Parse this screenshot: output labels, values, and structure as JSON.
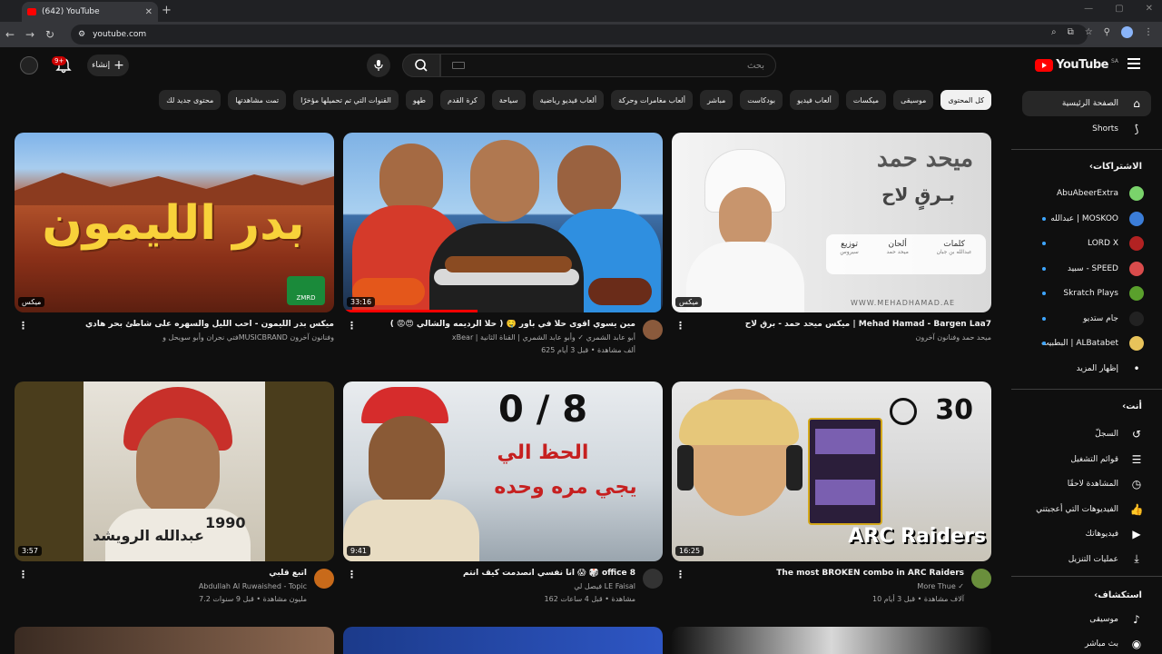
{
  "browser": {
    "tab_title": "(642) YouTube",
    "url": "youtube.com"
  },
  "masthead": {
    "logo": "YouTube",
    "region": "SA",
    "search_placeholder": "بحث",
    "create_label": "إنشاء",
    "notif_count": "9+"
  },
  "chips": [
    "كل المحتوى",
    "موسيقى",
    "ميكسات",
    "ألعاب فيديو",
    "بودكاست",
    "مباشر",
    "ألعاب مغامرات وحركة",
    "ألعاب فيديو رياضية",
    "سياحة",
    "كرة القدم",
    "طهو",
    "القنوات التي تم تحميلها مؤخرًا",
    "تمت مشاهدتها",
    "محتوى جديد لك"
  ],
  "sidebar": {
    "main": [
      {
        "label": "الصفحة الرئيسية",
        "icon": "home-icon"
      },
      {
        "label": "Shorts",
        "icon": "shorts-icon"
      }
    ],
    "subs_header": "الاشتراكات",
    "subs": [
      {
        "label": "AbuAbeerExtra",
        "color": "#7ad36b",
        "dot": false
      },
      {
        "label": "عبدالله | MOSKOO",
        "color": "#3b7dd8",
        "dot": true
      },
      {
        "label": "LORD X",
        "color": "#b22222",
        "dot": true
      },
      {
        "label": "سبيد - SPEED",
        "color": "#d94c4c",
        "dot": true
      },
      {
        "label": "Skratch Plays",
        "color": "#5aa02c",
        "dot": true
      },
      {
        "label": "جام ستديو",
        "color": "#222222",
        "dot": true
      },
      {
        "label": "البطبيت | ALBatabet",
        "color": "#e8c35a",
        "dot": true
      }
    ],
    "show_more": "إظهار المزيد",
    "you_header": "أنت",
    "you": [
      {
        "label": "السجلّ",
        "icon": "history-icon"
      },
      {
        "label": "قوائم التشغيل",
        "icon": "playlists-icon"
      },
      {
        "label": "المشاهدة لاحقًا",
        "icon": "watch-later-icon"
      },
      {
        "label": "الفيديوهات التي أعجبتني",
        "icon": "liked-icon"
      },
      {
        "label": "فيديوهاتك",
        "icon": "your-videos-icon"
      },
      {
        "label": "عمليات التنزيل",
        "icon": "downloads-icon"
      }
    ],
    "explore_header": "استكشاف",
    "explore": [
      {
        "label": "موسيقى",
        "icon": "music-icon"
      },
      {
        "label": "بث مباشر",
        "icon": "live-icon"
      }
    ]
  },
  "videos": [
    {
      "title": "ميكس ميحد حمد - برقٍ لاح | Mehad Hamad - Bargen Laa7",
      "channel": "ميحد حمد وفنانون آخرون",
      "stats": "",
      "badge": "ميكس",
      "thumb_big": "ميحد حمد",
      "thumb_sub": "بـرقٍ لاح",
      "thumb_site": "WWW.MEHADHAMAD.AE",
      "thumb_cols": [
        "كلمات",
        "ألحان",
        "توزيع"
      ],
      "thumb_vals": [
        "عبدالله بن جبان",
        "ميحد حمد",
        "سيروس"
      ]
    },
    {
      "title": "مين يسوي اقوى حلا في باور 🤤 ( حلا الرديمه والشالي 😍😡 )",
      "channel": "xBear | أبو عابد الشمري ✓ وأبو عابد الشمري | القناة الثانية",
      "stats": "625 ألف مشاهدة • قبل 3 أيام",
      "duration": "33:16",
      "progress": 0.42
    },
    {
      "title": "ميكس بدر الليمون - احب الليل والسهره على شاطئ بحر هادي",
      "channel": "فتي نجران وأبو سويحل وMUSICBRAND وفنانون آخرون",
      "stats": "",
      "badge": "ميكس",
      "thumb_big": "بدر الليمون",
      "thumb_logo": "ZMRD"
    },
    {
      "title": "The most BROKEN combo in ARC Raiders",
      "channel": "More Thue ✓",
      "stats": "10 آلاف مشاهدة • قبل 3 أيام",
      "duration": "16:25",
      "thumb_num": "30",
      "thumb_brand": "ARC Raiders"
    },
    {
      "title": "انا نفسي انصدمت كيف انتم 😱 🎲 office 8",
      "channel": "فيصل لي LE Faisal",
      "stats": "162 مشاهدة • قبل 4 ساعات",
      "duration": "9:41",
      "thumb_score": "0 / 8",
      "thumb_line1": "الحظ الي",
      "thumb_line2": "يجي مره وحده"
    },
    {
      "title": "اتبع قلبي",
      "channel": "Abdullah Al Ruwaished - Topic",
      "stats": "7.2 مليون مشاهدة • قبل 9 سنوات",
      "duration": "3:57",
      "thumb_name": "عبدالله الرويشد",
      "thumb_year": "1990"
    }
  ]
}
